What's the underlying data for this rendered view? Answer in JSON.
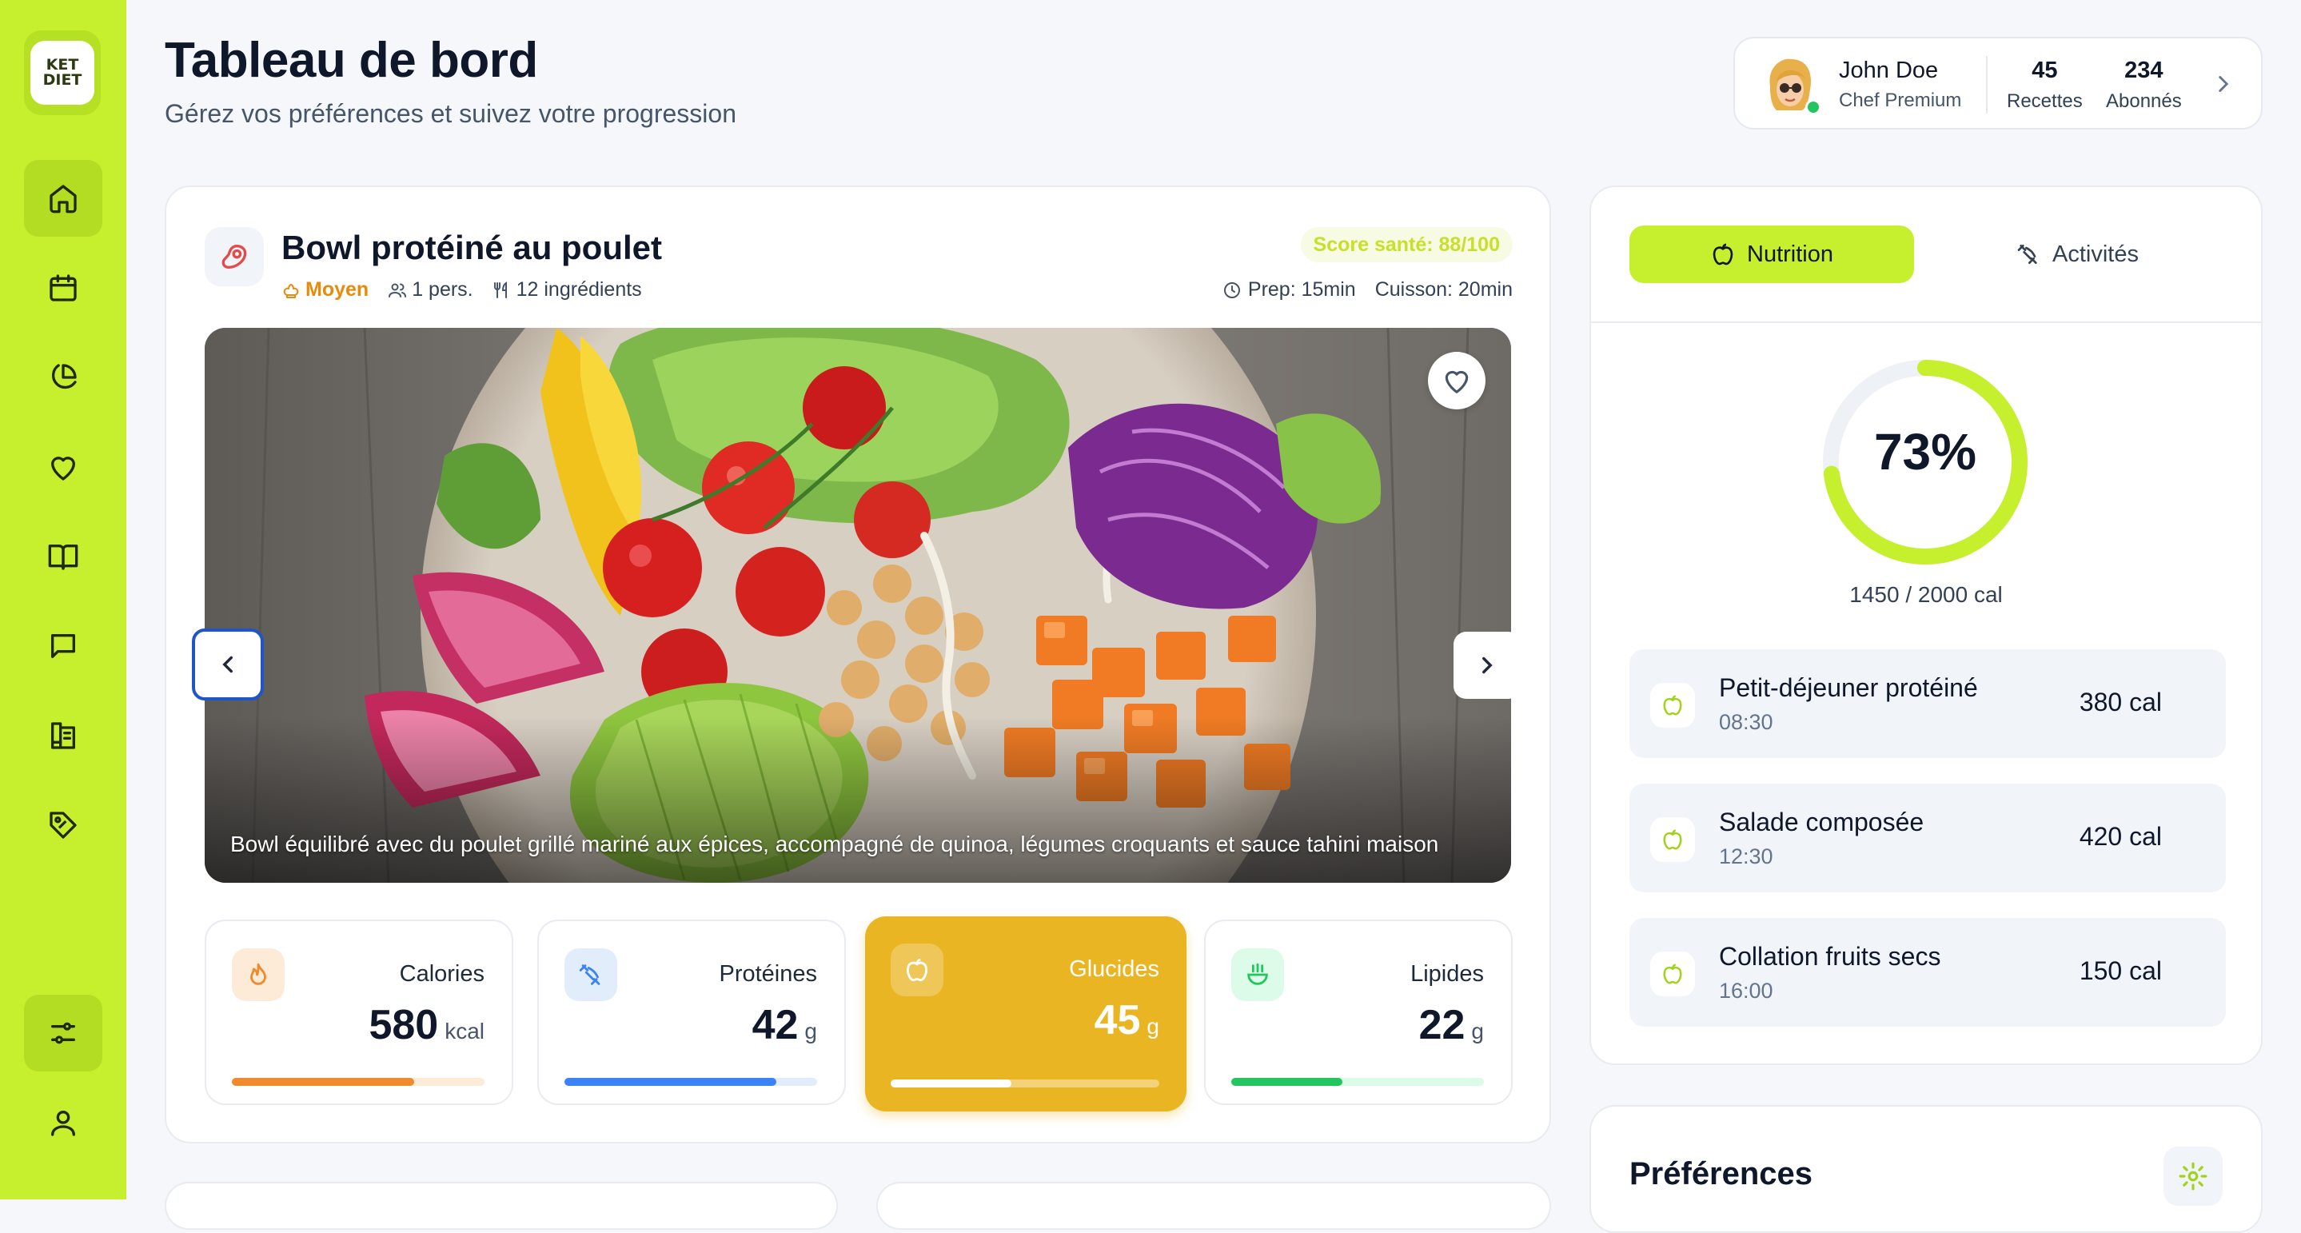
{
  "brand": {
    "logo_line1": "KET",
    "logo_line2": "DIET"
  },
  "sidebar": {
    "items": [
      "home-icon",
      "calendar-icon",
      "pie-chart-icon",
      "heart-icon",
      "book-open-icon",
      "message-icon",
      "recipe-book-icon",
      "tag-icon"
    ],
    "bottom_items": [
      "sliders-icon",
      "user-icon"
    ],
    "active_index": 0
  },
  "header": {
    "title": "Tableau de bord",
    "subtitle": "Gérez vos préférences et suivez votre progression"
  },
  "profile": {
    "name": "John Doe",
    "role": "Chef Premium",
    "recipes_count": "45",
    "recipes_label": "Recettes",
    "followers_count": "234",
    "followers_label": "Abonnés",
    "online": true
  },
  "recipe": {
    "title": "Bowl protéiné au poulet",
    "level": "Moyen",
    "servings": "1 pers.",
    "ingredients": "12 ingrédients",
    "score": "Score santé: 88/100",
    "prep": "Prep: 15min",
    "cook": "Cuisson: 20min",
    "caption": "Bowl équilibré avec du poulet grillé mariné aux épices, accompagné de quinoa, légumes croquants et sauce tahini maison"
  },
  "nutrients": [
    {
      "label": "Calories",
      "value": "580",
      "unit": "kcal",
      "progress": 0.72,
      "color": "#f08a2c",
      "track": "#fdebd8",
      "icon": "flame-icon"
    },
    {
      "label": "Protéines",
      "value": "42",
      "unit": "g",
      "progress": 0.84,
      "color": "#3b82f6",
      "track": "#e2edfc",
      "icon": "protein-icon"
    },
    {
      "label": "Glucides",
      "value": "45",
      "unit": "g",
      "progress": 0.45,
      "color": "#ffffff",
      "track": "#f4d27a",
      "icon": "apple-icon"
    },
    {
      "label": "Lipides",
      "value": "22",
      "unit": "g",
      "progress": 0.44,
      "color": "#22c55e",
      "track": "#dcfbe8",
      "icon": "lipid-icon"
    }
  ],
  "side": {
    "tabs": [
      {
        "label": "Nutrition",
        "icon": "apple-icon",
        "active": true
      },
      {
        "label": "Activités",
        "icon": "dumbbell-icon",
        "active": false
      }
    ],
    "donut_percent": "73%",
    "donut_fraction": 0.73,
    "calories_text": "1450 / 2000 cal",
    "meals": [
      {
        "name": "Petit-déjeuner protéiné",
        "time": "08:30",
        "cal": "380 cal"
      },
      {
        "name": "Salade composée",
        "time": "12:30",
        "cal": "420 cal"
      },
      {
        "name": "Collation fruits secs",
        "time": "16:00",
        "cal": "150 cal"
      }
    ]
  },
  "preferences": {
    "title": "Préférences"
  },
  "colors": {
    "accent": "#c6ef2e",
    "highlight": "#eab522"
  }
}
